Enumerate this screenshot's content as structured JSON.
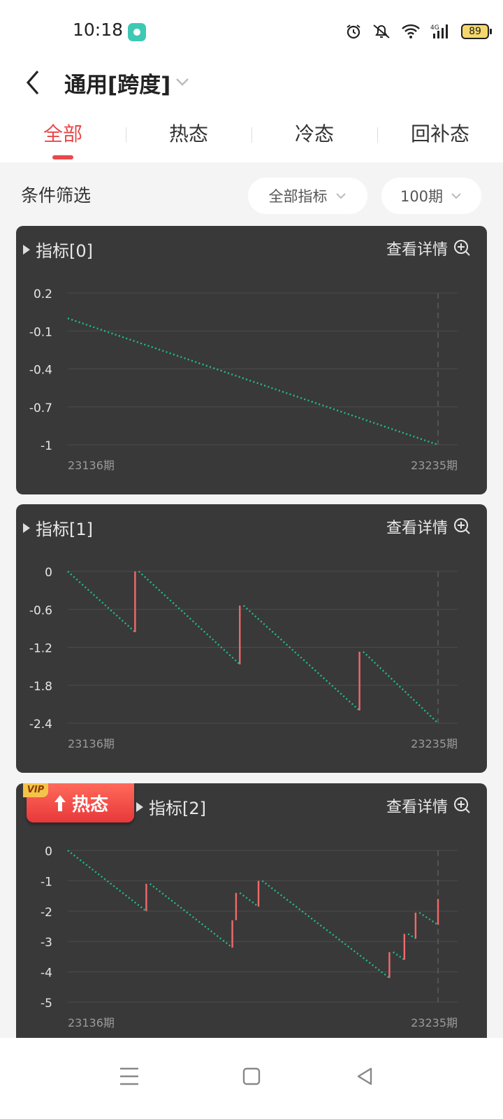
{
  "status_bar": {
    "time": "10:18",
    "battery": "89",
    "network": "4G"
  },
  "header": {
    "title": "通用[跨度]"
  },
  "tabs": [
    {
      "label": "全部",
      "active": true
    },
    {
      "label": "热态",
      "active": false
    },
    {
      "label": "冷态",
      "active": false
    },
    {
      "label": "回补态",
      "active": false
    }
  ],
  "filter": {
    "label": "条件筛选",
    "indicator_select": "全部指标",
    "period_select": "100期"
  },
  "colors": {
    "accent": "#e8484a",
    "card_bg": "#393939",
    "up_line": "#f06a6a",
    "down_dots": "#1fbf8f"
  },
  "cards": [
    {
      "title": "指标[0]",
      "detail": "查看详情",
      "badge": null,
      "chart_data": {
        "type": "line",
        "y_ticks": [
          "0.2",
          "-0.1",
          "-0.4",
          "-0.7",
          "-1"
        ],
        "ylim": [
          -1,
          0.2
        ],
        "x_start": "23136期",
        "x_end": "23235期",
        "segments": [
          {
            "kind": "down",
            "from": [
              0,
              0
            ],
            "to": [
              99,
              -1
            ]
          }
        ]
      }
    },
    {
      "title": "指标[1]",
      "detail": "查看详情",
      "badge": null,
      "chart_data": {
        "type": "line",
        "y_ticks": [
          "0",
          "-0.6",
          "-1.2",
          "-1.8",
          "-2.4"
        ],
        "ylim": [
          -2.4,
          0
        ],
        "x_start": "23136期",
        "x_end": "23235期",
        "segments": [
          {
            "kind": "down",
            "from": [
              0,
              0
            ],
            "to": [
              18,
              -0.96
            ]
          },
          {
            "kind": "up",
            "from": [
              18,
              -0.96
            ],
            "to": [
              18,
              0
            ]
          },
          {
            "kind": "down",
            "from": [
              19,
              0
            ],
            "to": [
              46,
              -1.47
            ]
          },
          {
            "kind": "up",
            "from": [
              46,
              -1.47
            ],
            "to": [
              46,
              -0.54
            ]
          },
          {
            "kind": "down",
            "from": [
              47,
              -0.54
            ],
            "to": [
              78,
              -2.2
            ]
          },
          {
            "kind": "up",
            "from": [
              78,
              -2.2
            ],
            "to": [
              78,
              -1.27
            ]
          },
          {
            "kind": "down",
            "from": [
              79,
              -1.27
            ],
            "to": [
              99,
              -2.4
            ]
          }
        ]
      }
    },
    {
      "title": "指标[2]",
      "detail": "查看详情",
      "badge": {
        "vip": "VIP",
        "label": "热态"
      },
      "chart_data": {
        "type": "line",
        "y_ticks": [
          "0",
          "-1",
          "-2",
          "-3",
          "-4",
          "-5"
        ],
        "ylim": [
          -5,
          0
        ],
        "x_start": "23136期",
        "x_end": "23235期",
        "segments": [
          {
            "kind": "down",
            "from": [
              0,
              0
            ],
            "to": [
              21,
              -2
            ]
          },
          {
            "kind": "up",
            "from": [
              21,
              -2
            ],
            "to": [
              21,
              -1.1
            ]
          },
          {
            "kind": "down",
            "from": [
              22,
              -1.1
            ],
            "to": [
              44,
              -3.2
            ]
          },
          {
            "kind": "up",
            "from": [
              44,
              -3.2
            ],
            "to": [
              44,
              -2.3
            ]
          },
          {
            "kind": "up",
            "from": [
              45,
              -2.3
            ],
            "to": [
              45,
              -1.4
            ]
          },
          {
            "kind": "down",
            "from": [
              46,
              -1.4
            ],
            "to": [
              51,
              -1.85
            ]
          },
          {
            "kind": "up",
            "from": [
              51,
              -1.85
            ],
            "to": [
              51,
              -1
            ]
          },
          {
            "kind": "down",
            "from": [
              52,
              -1
            ],
            "to": [
              86,
              -4.2
            ]
          },
          {
            "kind": "up",
            "from": [
              86,
              -4.2
            ],
            "to": [
              86,
              -3.35
            ]
          },
          {
            "kind": "down",
            "from": [
              87,
              -3.35
            ],
            "to": [
              90,
              -3.6
            ]
          },
          {
            "kind": "up",
            "from": [
              90,
              -3.6
            ],
            "to": [
              90,
              -2.75
            ]
          },
          {
            "kind": "down",
            "from": [
              91,
              -2.75
            ],
            "to": [
              93,
              -2.9
            ]
          },
          {
            "kind": "up",
            "from": [
              93,
              -2.9
            ],
            "to": [
              93,
              -2.05
            ]
          },
          {
            "kind": "down",
            "from": [
              94,
              -2.05
            ],
            "to": [
              99,
              -2.45
            ]
          },
          {
            "kind": "up",
            "from": [
              99,
              -2.45
            ],
            "to": [
              99,
              -1.6
            ]
          }
        ]
      }
    }
  ]
}
